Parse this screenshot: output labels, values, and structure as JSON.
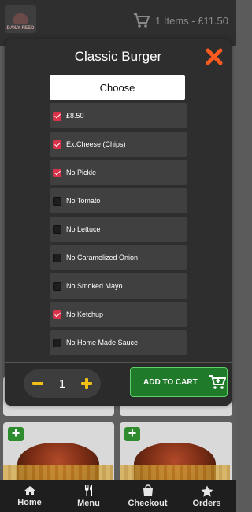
{
  "header": {
    "logo_text": "DAILY FEED",
    "cart_summary": "1 Items - £11.50"
  },
  "modal": {
    "title": "Classic Burger",
    "section_header": "Choose",
    "options": [
      {
        "label": "£8.50",
        "checked": true
      },
      {
        "label": "Ex.Cheese (Chips)",
        "checked": true
      },
      {
        "label": "No Pickle",
        "checked": true
      },
      {
        "label": "No Tomato",
        "checked": false
      },
      {
        "label": "No Lettuce",
        "checked": false
      },
      {
        "label": "No Caramelized Onion",
        "checked": false
      },
      {
        "label": "No Smoked Mayo",
        "checked": false
      },
      {
        "label": "No Ketchup",
        "checked": true
      },
      {
        "label": "No Home Made Sauce",
        "checked": false
      }
    ],
    "quantity": "1",
    "add_to_cart_label": "ADD TO CART"
  },
  "bottom_nav": [
    {
      "label": "Home",
      "icon": "home-icon"
    },
    {
      "label": "Menu",
      "icon": "fork-knife-icon"
    },
    {
      "label": "Checkout",
      "icon": "shopping-bag-icon"
    },
    {
      "label": "Orders",
      "icon": "star-icon"
    }
  ],
  "colors": {
    "checkbox_checked": "#d8334a",
    "close_icon": "#ff5a1f",
    "add_to_cart_bg": "#1f7a2a",
    "quantity_buttons": "#f2c118"
  }
}
